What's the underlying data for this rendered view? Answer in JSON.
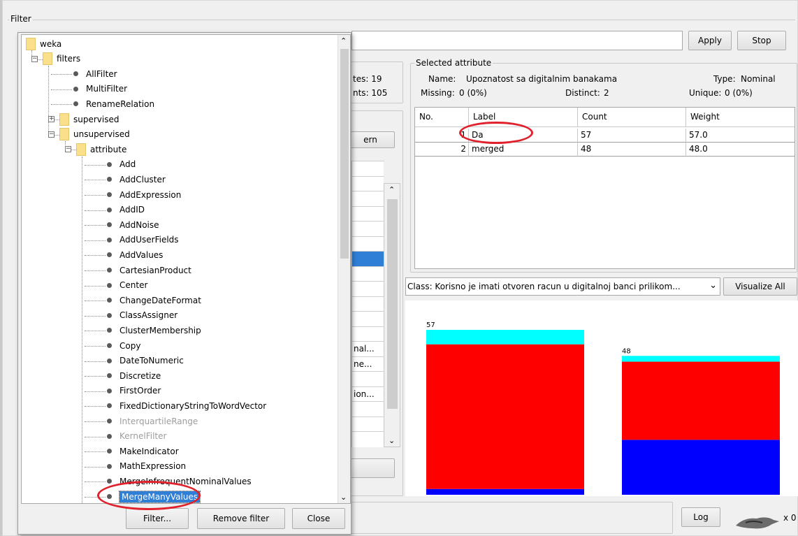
{
  "filter": {
    "group_label": "Filter",
    "apply_label": "Apply",
    "stop_label": "Stop"
  },
  "current_relation": {
    "attributes_partial": "tes: 19",
    "instances_partial": "nts: 105"
  },
  "attributes_panel": {
    "pattern_button_partial": "ern",
    "visible_row_texts": [
      "",
      "",
      "",
      "",
      "",
      "",
      "",
      "",
      "",
      "",
      "",
      "",
      "nal...",
      "ne...",
      "",
      "ion...",
      "",
      "",
      ""
    ]
  },
  "selected_attribute": {
    "group_label": "Selected attribute",
    "name_label": "Name:",
    "name_value": "Upoznatost sa digitalnim banakama",
    "type_label": "Type:",
    "type_value": "Nominal",
    "missing_label": "Missing:",
    "missing_value": "0 (0%)",
    "distinct_label": "Distinct:",
    "distinct_value": "2",
    "unique_label": "Unique:",
    "unique_value": "0 (0%)"
  },
  "table": {
    "headers": [
      "No.",
      "Label",
      "Count",
      "Weight"
    ],
    "rows": [
      {
        "no": "1",
        "label": "Da",
        "count": "57",
        "weight": "57.0"
      },
      {
        "no": "2",
        "label": "merged",
        "count": "48",
        "weight": "48.0"
      }
    ]
  },
  "class_selector": {
    "value": "Class: Korisno je imati otvoren racun u digitalnoj banci prilikom...",
    "visualize_all_label": "Visualize All"
  },
  "chart_data": {
    "type": "bar",
    "stacked": true,
    "categories": [
      "Da",
      "merged"
    ],
    "totals": [
      57,
      48
    ],
    "total_labels": [
      "57",
      "48"
    ],
    "series": [
      {
        "color": "#0000ff",
        "values": [
          2,
          19
        ]
      },
      {
        "color": "#ff0000",
        "values": [
          50,
          27
        ]
      },
      {
        "color": "#00ffff",
        "values": [
          5,
          2
        ]
      }
    ]
  },
  "status": {
    "log_label": "Log",
    "x_label": "x 0"
  },
  "tree_dialog": {
    "items": [
      {
        "label": "weka",
        "kind": "folder",
        "indent": 0
      },
      {
        "label": "filters",
        "kind": "folder",
        "indent": 1
      },
      {
        "label": "AllFilter",
        "kind": "leaf",
        "indent": 2
      },
      {
        "label": "MultiFilter",
        "kind": "leaf",
        "indent": 2
      },
      {
        "label": "RenameRelation",
        "kind": "leaf",
        "indent": 2
      },
      {
        "label": "supervised",
        "kind": "folder",
        "indent": 2
      },
      {
        "label": "unsupervised",
        "kind": "folder",
        "indent": 2
      },
      {
        "label": "attribute",
        "kind": "folder",
        "indent": 3
      },
      {
        "label": "Add",
        "kind": "leaf",
        "indent": 4
      },
      {
        "label": "AddCluster",
        "kind": "leaf",
        "indent": 4
      },
      {
        "label": "AddExpression",
        "kind": "leaf",
        "indent": 4
      },
      {
        "label": "AddID",
        "kind": "leaf",
        "indent": 4
      },
      {
        "label": "AddNoise",
        "kind": "leaf",
        "indent": 4
      },
      {
        "label": "AddUserFields",
        "kind": "leaf",
        "indent": 4
      },
      {
        "label": "AddValues",
        "kind": "leaf",
        "indent": 4
      },
      {
        "label": "CartesianProduct",
        "kind": "leaf",
        "indent": 4
      },
      {
        "label": "Center",
        "kind": "leaf",
        "indent": 4
      },
      {
        "label": "ChangeDateFormat",
        "kind": "leaf",
        "indent": 4
      },
      {
        "label": "ClassAssigner",
        "kind": "leaf",
        "indent": 4
      },
      {
        "label": "ClusterMembership",
        "kind": "leaf",
        "indent": 4
      },
      {
        "label": "Copy",
        "kind": "leaf",
        "indent": 4
      },
      {
        "label": "DateToNumeric",
        "kind": "leaf",
        "indent": 4
      },
      {
        "label": "Discretize",
        "kind": "leaf",
        "indent": 4
      },
      {
        "label": "FirstOrder",
        "kind": "leaf",
        "indent": 4
      },
      {
        "label": "FixedDictionaryStringToWordVector",
        "kind": "leaf",
        "indent": 4
      },
      {
        "label": "InterquartileRange",
        "kind": "leaf",
        "indent": 4,
        "disabled": true
      },
      {
        "label": "KernelFilter",
        "kind": "leaf",
        "indent": 4,
        "disabled": true
      },
      {
        "label": "MakeIndicator",
        "kind": "leaf",
        "indent": 4
      },
      {
        "label": "MathExpression",
        "kind": "leaf",
        "indent": 4
      },
      {
        "label": "MergeInfrequentNominalValues",
        "kind": "leaf",
        "indent": 4
      },
      {
        "label": "MergeManyValues",
        "kind": "leaf",
        "indent": 4,
        "selected": true
      }
    ],
    "filter_button_label": "Filter...",
    "remove_filter_label": "Remove filter",
    "close_label": "Close"
  }
}
